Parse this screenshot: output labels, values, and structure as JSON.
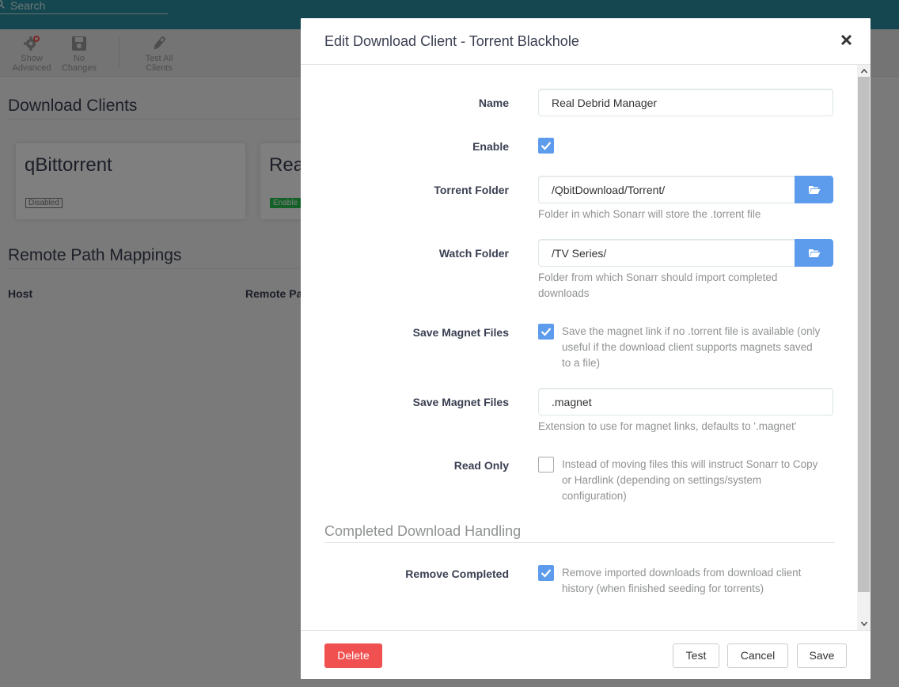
{
  "search": {
    "placeholder": "Search"
  },
  "toolbar": {
    "show_advanced": [
      "Show",
      "Advanced"
    ],
    "no_changes": [
      "No",
      "Changes"
    ],
    "test_all_clients": [
      "Test All",
      "Clients"
    ]
  },
  "page": {
    "download_clients_title": "Download Clients",
    "clients": [
      {
        "name": "qBittorrent",
        "status": "Disabled"
      },
      {
        "name": "Rea",
        "status": "Enable"
      }
    ],
    "remote_path_mappings_title": "Remote Path Mappings",
    "columns": [
      "Host",
      "Remote Pa"
    ]
  },
  "modal": {
    "title": "Edit Download Client - Torrent Blackhole",
    "close_label": "×",
    "fields": {
      "name": {
        "label": "Name",
        "value": "Real Debrid Manager"
      },
      "enable": {
        "label": "Enable",
        "checked": true
      },
      "torrent_folder": {
        "label": "Torrent Folder",
        "value": "/QbitDownload/Torrent/",
        "help": "Folder in which Sonarr will store the .torrent file"
      },
      "watch_folder": {
        "label": "Watch Folder",
        "value": "/TV Series/",
        "help_lines": [
          "Folder from which Sonarr should import completed",
          "downloads"
        ]
      },
      "save_magnet_files": {
        "label": "Save Magnet Files",
        "checked": true,
        "help_lines": [
          "Save the magnet link if no .torrent file is available (only",
          "useful if the download client supports magnets saved",
          "to a file)"
        ]
      },
      "magnet_extension": {
        "label": "Save Magnet Files",
        "value": ".magnet",
        "help": "Extension to use for magnet links, defaults to '.magnet'"
      },
      "read_only": {
        "label": "Read Only",
        "checked": false,
        "help_lines": [
          "Instead of moving files this will instruct Sonarr to Copy",
          "or Hardlink (depending on settings/system",
          "configuration)"
        ]
      }
    },
    "completed_download_handling": {
      "legend": "Completed Download Handling",
      "remove_completed": {
        "label": "Remove Completed",
        "checked": true,
        "help_lines": [
          "Remove imported downloads from download client",
          "history (when finished seeding for torrents)"
        ]
      }
    },
    "footer": {
      "delete": "Delete",
      "test": "Test",
      "cancel": "Cancel",
      "save": "Save"
    }
  },
  "colors": {
    "header": "#2a8fa0",
    "primary": "#5d9cec",
    "danger": "#f05050",
    "success": "#27c24c"
  },
  "icons": [
    "search-icon",
    "gear-icon",
    "save-icon",
    "pencil-icon",
    "close-icon",
    "folder-open-icon",
    "check-icon",
    "chevron-up-icon",
    "chevron-down-icon"
  ]
}
